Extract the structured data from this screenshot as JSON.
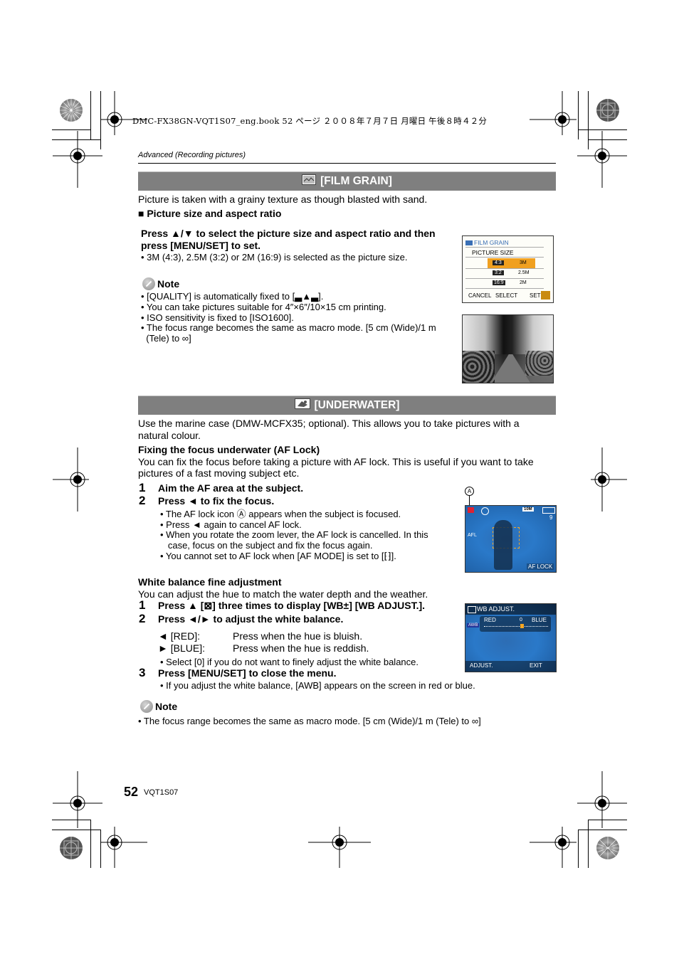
{
  "book_header": "DMC-FX38GN-VQT1S07_eng.book  52 ページ  ２００８年７月７日  月曜日  午後８時４２分",
  "running_head": "Advanced (Recording pictures)",
  "film_grain": {
    "title": "[FILM GRAIN]",
    "icon": "film-grain-scene-icon",
    "intro": "Picture is taken with a grainy texture as though blasted with sand.",
    "subheading": "■ Picture size and aspect ratio",
    "instruction_line1": "Press ▲/▼ to select the picture size and aspect ratio and then",
    "instruction_line2": "press [MENU/SET] to set.",
    "instruction_bullet": "• 3M (4:3), 2.5M (3:2) or 2M (16:9) is selected as the picture size.",
    "note_label": "Note",
    "notes": [
      "• [QUALITY] is automatically fixed to [▃▲▃].",
      "• You can take pictures suitable for 4″×6″/10×15 cm printing.",
      "• ISO sensitivity is fixed to [ISO1600].",
      "• The focus range becomes the same as macro mode. [5 cm (Wide)/1 m",
      "  (Tele) to ∞]"
    ],
    "lcd": {
      "title": "FILM GRAIN",
      "subtitle": "PICTURE SIZE",
      "options": [
        {
          "aspect": "4:3",
          "size": "3M",
          "selected": true
        },
        {
          "aspect": "3:2",
          "size": "2.5M",
          "selected": false
        },
        {
          "aspect": "16:9",
          "size": "2M",
          "selected": false
        }
      ],
      "footer_cancel": "CANCEL",
      "footer_select": "SELECT",
      "footer_set": "SET"
    }
  },
  "underwater": {
    "title": "[UNDERWATER]",
    "icon": "underwater-scene-icon",
    "intro_line1": "Use the marine case (DMW-MCFX35; optional). This allows you to take pictures with a",
    "intro_line2": "natural colour.",
    "af_lock": {
      "heading": "Fixing the focus underwater (AF Lock)",
      "desc_line1": "You can fix the focus before taking a picture with AF lock. This is useful if you want to take",
      "desc_line2": "pictures of a fast moving subject etc.",
      "steps": [
        {
          "num": "1",
          "text": "Aim the AF area at the subject."
        },
        {
          "num": "2",
          "text": "Press ◄ to fix the focus."
        }
      ],
      "bullets": [
        "• The AF lock icon Ⓐ appears when the subject is focused.",
        "• Press ◄ again to cancel AF lock.",
        "• When you rotate the zoom lever, the AF lock is cancelled. In this",
        "   case, focus on the subject and fix the focus again.",
        "• You cannot set to AF lock when [AF MODE] is set to [⁅⁆]."
      ],
      "callout_label": "A",
      "lcd": {
        "size_badge": "10M",
        "count": "9",
        "afl": "AFL",
        "af_lock_text": "AF LOCK"
      }
    },
    "wb": {
      "heading": "White balance fine adjustment",
      "desc": "You can adjust the hue to match the water depth and the weather.",
      "steps": [
        {
          "num": "1",
          "text": "Press ▲ [⊠] three times to display [WB±] [WB ADJUST.]."
        },
        {
          "num": "2",
          "text": "Press ◄/► to adjust the white balance."
        },
        {
          "num": "3",
          "text": "Press [MENU/SET] to close the menu."
        }
      ],
      "table": [
        {
          "key": "◄ [RED]:",
          "value": "Press when the hue is bluish."
        },
        {
          "key": "► [BLUE]:",
          "value": "Press when the hue is reddish."
        }
      ],
      "step2_bullet": "• Select [0] if you do not want to finely adjust the white balance.",
      "step3_bullet": "• If you adjust the white balance, [AWB] appears on the screen in red or blue.",
      "lcd": {
        "title": "WB ADJUST.",
        "awb": "AWB",
        "red": "RED",
        "zero": "0",
        "blue": "BLUE",
        "adjust": "ADJUST.",
        "exit": "EXIT"
      }
    },
    "note_label": "Note",
    "note": "• The focus range becomes the same as macro mode. [5 cm (Wide)/1 m (Tele) to ∞]"
  },
  "footer": {
    "page_number": "52",
    "code": "VQT1S07"
  }
}
